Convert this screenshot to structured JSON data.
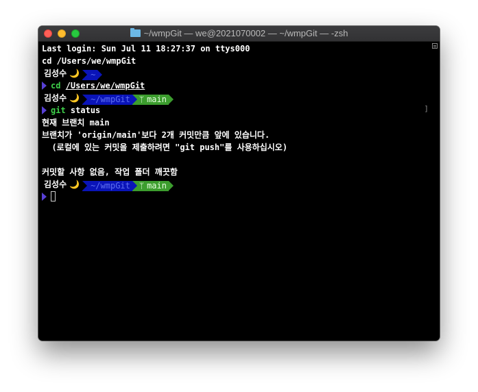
{
  "window": {
    "title": "~/wmpGit — we@2021070002 — ~/wmpGit — -zsh",
    "title_icon": "folder-icon"
  },
  "terminal": {
    "last_login": "Last login: Sun Jul 11 18:27:37 on ttys000",
    "first_cmd": "cd /Users/we/wmpGit",
    "prompt_user": "김성수",
    "moon_glyph": "🌙",
    "prompt1_path": "~",
    "cmd1_name": "cd",
    "cmd1_arg": "/Users/we/wmpGit",
    "prompt2_path": "~/wmpGit",
    "prompt2_branch": "main",
    "cmd2_name": "git",
    "cmd2_arg": "status",
    "out1": "현재 브랜치 main",
    "out2": "브랜치가 'origin/main'보다 2개 커밋만큼 앞에 있습니다.",
    "out3": "  (로컬에 있는 커밋을 제출하려면 \"git push\"를 사용하십시오)",
    "out4": "",
    "out5": "커밋할 사항 없음, 작업 폴더 깨끗함",
    "prompt3_path": "~/wmpGit",
    "prompt3_branch": "main",
    "branch_glyph": "ᛘ",
    "right_mark": "]"
  },
  "colors": {
    "path_segment": "#0a14b8",
    "git_segment": "#3c9d2e",
    "command": "#3fd14b",
    "prompt_caret": "#5840d6",
    "moon": "#f2c14e"
  }
}
